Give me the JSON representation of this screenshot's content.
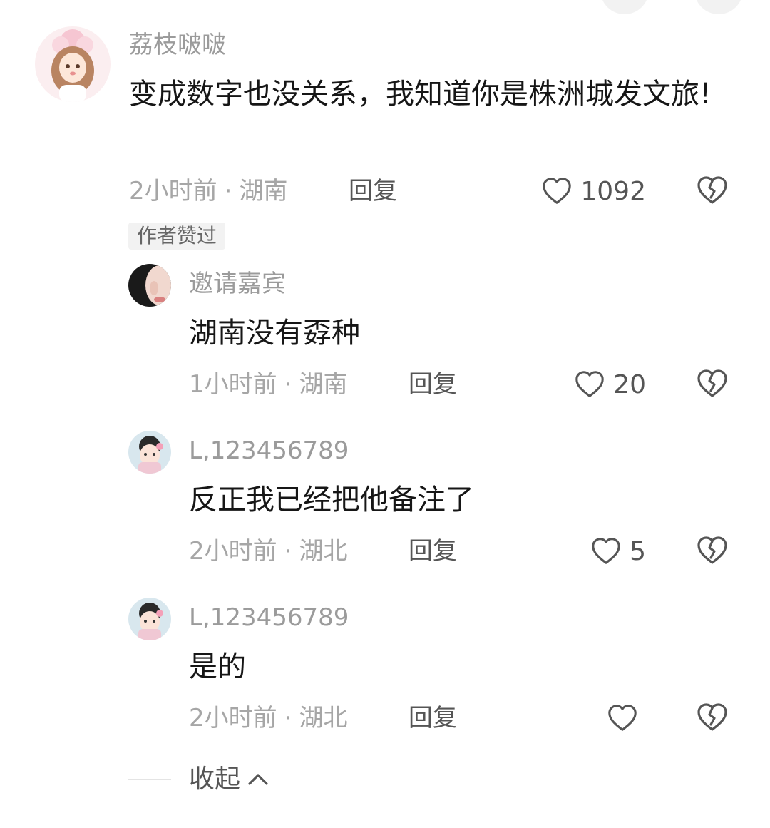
{
  "comments": [
    {
      "username": "荔枝啵啵",
      "content": "变成数字也没关系，我知道你是株洲城发文旅!",
      "time": "2小时前",
      "location": "湖南",
      "reply_label": "回复",
      "likes": "1092",
      "badge": "作者赞过"
    }
  ],
  "replies": [
    {
      "username": "邀请嘉宾",
      "content": "湖南没有孬种",
      "time": "1小时前",
      "location": "湖南",
      "reply_label": "回复",
      "likes": "20"
    },
    {
      "username": "L,123456789",
      "content": "反正我已经把他备注了",
      "time": "2小时前",
      "location": "湖北",
      "reply_label": "回复",
      "likes": "5"
    },
    {
      "username": "L,123456789",
      "content": "是的",
      "time": "2小时前",
      "location": "湖北",
      "reply_label": "回复",
      "likes": ""
    }
  ],
  "collapse_label": "收起",
  "separator": "·",
  "colors": {
    "username": "#9b9b9b",
    "content": "#161616",
    "meta": "#a6a6a6",
    "action": "#555555"
  },
  "icons": {
    "like": "heart-outline-icon",
    "dislike": "broken-heart-icon",
    "collapse": "chevron-up-icon"
  }
}
